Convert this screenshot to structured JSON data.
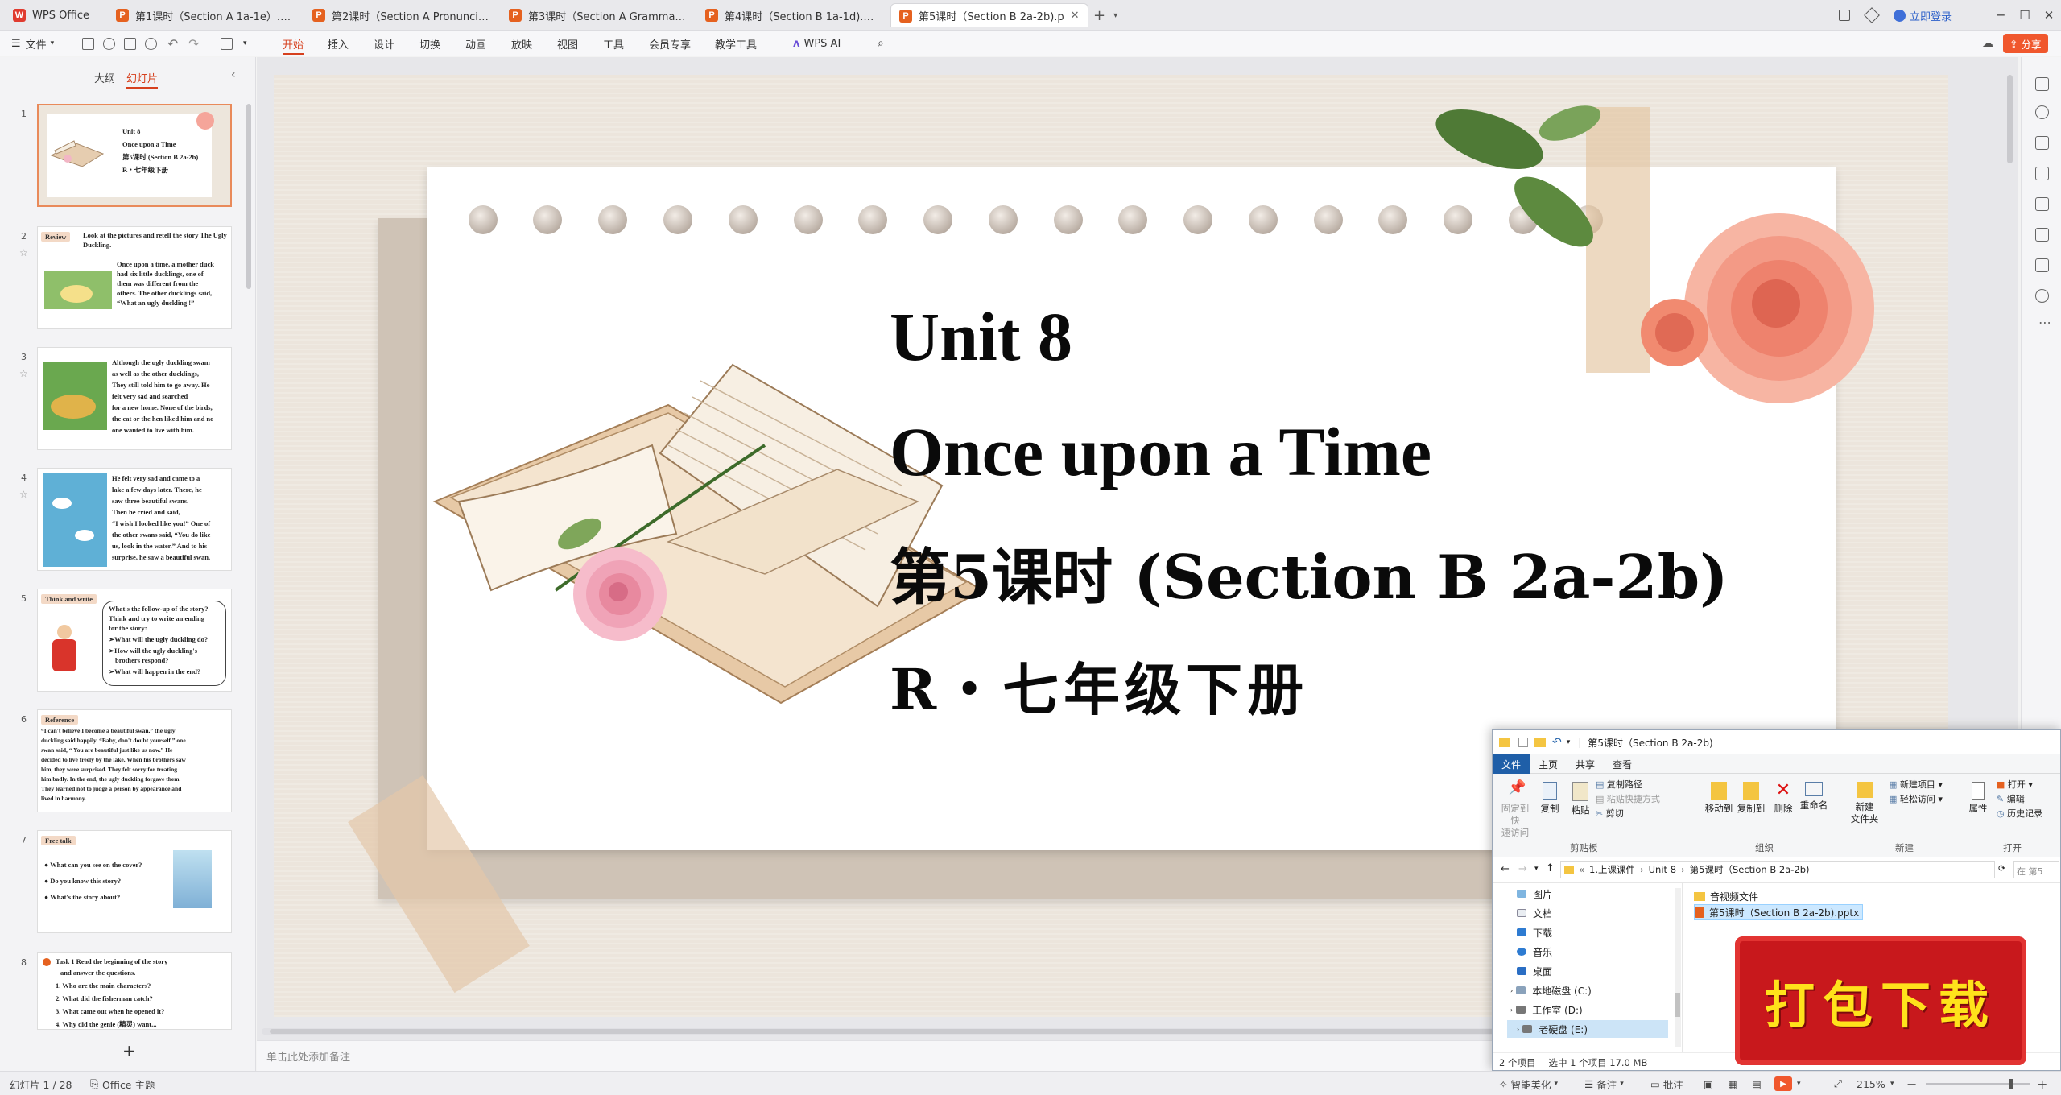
{
  "tabs": [
    {
      "label": "WPS Office",
      "kind": "wps"
    },
    {
      "label": "第1课时（Section A 1a-1e）.pptx",
      "kind": "p"
    },
    {
      "label": "第2课时（Section A Pronunciation",
      "kind": "p"
    },
    {
      "label": "第3课时（Section A Grammar Focu",
      "kind": "p"
    },
    {
      "label": "第4课时（Section B 1a-1d).pptx",
      "kind": "p"
    },
    {
      "label": "第5课时（Section B 2a-2b).p",
      "kind": "p",
      "active": true
    }
  ],
  "titlebar": {
    "login": "立即登录",
    "add_tab": "+",
    "share": "分享"
  },
  "menu": {
    "file": "文件",
    "items": [
      "开始",
      "插入",
      "设计",
      "切换",
      "动画",
      "放映",
      "视图",
      "工具",
      "会员专享",
      "教学工具"
    ],
    "active": "开始",
    "wps_ai": "WPS AI"
  },
  "left_panel": {
    "tabs": [
      "大纲",
      "幻灯片"
    ],
    "active_tab": "幻灯片",
    "add_slide": "+",
    "thumbs": [
      {
        "num": "1",
        "lines": [
          "Unit 8",
          "Once upon a Time",
          "第5课时 (Section B 2a-2b)",
          "R・七年级下册"
        ]
      },
      {
        "num": "2",
        "tag": "Review",
        "head": "Look at the pictures and retell the story The Ugly Duckling.",
        "body": [
          "Once upon a time, a mother duck",
          "had six little ducklings, one of",
          "them was different from the",
          "others. The other ducklings said,",
          "“What an ugly duckling !”"
        ]
      },
      {
        "num": "3",
        "body": [
          "Although the ugly duckling swam",
          "as well as the other ducklings,",
          "They still told him to go away. He",
          "felt very sad and searched",
          "for a new home. None of the birds,",
          "the cat or the hen liked him and no",
          "one wanted to live with him."
        ]
      },
      {
        "num": "4",
        "body": [
          "He felt very sad and came to a",
          "lake a few days later. There, he",
          "saw three beautiful swans.",
          "Then he cried and said,",
          "“I wish I looked like you!” One of",
          "the other swans said, “You do like",
          "us, look in the water.” And to his",
          "surprise, he saw a beautiful swan."
        ]
      },
      {
        "num": "5",
        "tag": "Think and write",
        "body": [
          "What's the follow-up of the story?",
          "Think and try to write an ending",
          "for the story:",
          "➢What will the ugly duckling do?",
          "➢How will the ugly duckling's",
          "brothers respond?",
          "➢What will happen in the end?"
        ]
      },
      {
        "num": "6",
        "tag": "Reference",
        "body": [
          "“I can't believe I become a beautiful swan.” the ugly",
          "duckling said happily. “Baby, don't doubt yourself.” one",
          "swan said, “ You are beautiful just like us now.” He",
          "decided to live freely by the lake. When his brothers saw",
          "him, they were surprised. They felt sorry for treating",
          "him badly. In the end, the ugly duckling forgave them.",
          "They learned not to judge a person by appearance and",
          "lived in harmony."
        ]
      },
      {
        "num": "7",
        "tag": "Free talk",
        "body": [
          "● What can you see on the cover?",
          "● Do you know this story?",
          "● What's the story about?"
        ]
      },
      {
        "num": "8",
        "body": [
          "Task 1  Read the beginning of the story",
          "and answer the questions.",
          "1. Who are the main characters?",
          "2. What did the fisherman catch?",
          "3. What came out when he opened it?",
          "4. Why did the genie (精灵) want..."
        ]
      }
    ]
  },
  "slide": {
    "line1": "Unit 8",
    "line2": "Once upon a Time",
    "line3": "第5课时 (Section B 2a-2b)",
    "line4": "R・七年级下册"
  },
  "notes_placeholder": "单击此处添加备注",
  "status": {
    "slide_info": "幻灯片 1 / 28",
    "theme": "Office 主题",
    "smart": "智能美化",
    "notes": "备注",
    "comment": "批注",
    "zoom": "215%"
  },
  "explorer": {
    "title": "第5课时（Section B 2a-2b)",
    "tabs": [
      "文件",
      "主页",
      "共享",
      "查看"
    ],
    "active_tab": "文件",
    "ribbon": {
      "pin": "固定到快\n速访问",
      "copy": "复制",
      "paste": "粘贴",
      "copy_path": "复制路径",
      "paste_shortcut": "粘贴快捷方式",
      "cut": "剪切",
      "clipboard_group": "剪贴板",
      "move_to": "移动到",
      "copy_to": "复制到",
      "delete": "删除",
      "rename": "重命名",
      "organize_group": "组织",
      "new_folder": "新建\n文件夹",
      "new_item": "新建项目",
      "easy_access": "轻松访问",
      "new_group": "新建",
      "properties": "属性",
      "open": "打开",
      "edit": "编辑",
      "history": "历史记录",
      "open_group": "打开"
    },
    "path": [
      "1.上课课件",
      "Unit 8",
      "第5课时（Section B 2a-2b)"
    ],
    "search_placeholder": "在 第5",
    "nav": [
      "图片",
      "文档",
      "下载",
      "音乐",
      "桌面",
      "本地磁盘 (C:)",
      "工作室 (D:)",
      "老硬盘 (E:)"
    ],
    "nav_selected": "老硬盘 (E:)",
    "files": [
      {
        "name": "音视频文件",
        "type": "folder"
      },
      {
        "name": "第5课时（Section B 2a-2b).pptx",
        "type": "pptx",
        "selected": true
      }
    ],
    "status": {
      "count": "2 个项目",
      "selected": "选中 1 个项目  17.0 MB"
    }
  },
  "download_badge": "打包下载",
  "colors": {
    "accent": "#d6401e",
    "explorer_accent": "#1f5fa8",
    "badge": "#c8181c",
    "badge_text": "#ffe21b"
  }
}
